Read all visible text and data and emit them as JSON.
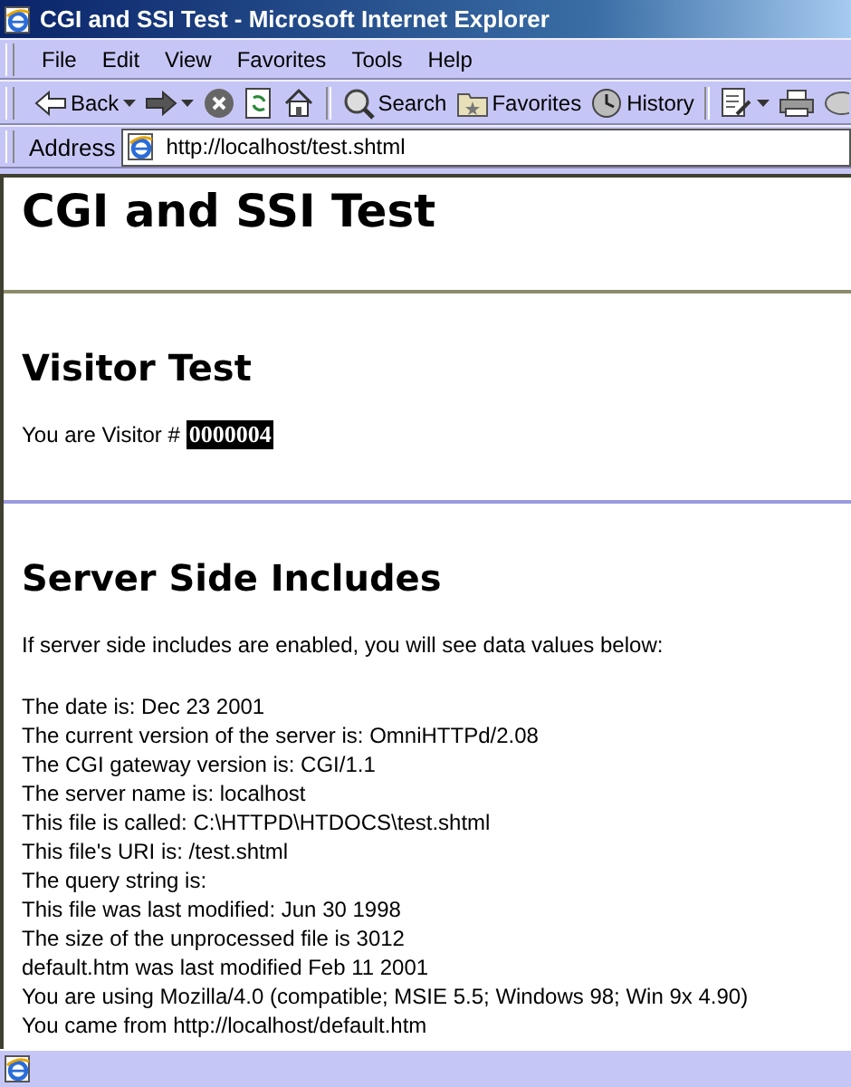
{
  "window": {
    "title": "CGI and SSI Test - Microsoft Internet Explorer"
  },
  "menu": [
    "File",
    "Edit",
    "View",
    "Favorites",
    "Tools",
    "Help"
  ],
  "toolbar": [
    {
      "kind": "back",
      "label": "Back",
      "dropdown": true
    },
    {
      "kind": "forward",
      "dropdown": true
    },
    {
      "kind": "stop"
    },
    {
      "kind": "refresh"
    },
    {
      "kind": "home"
    },
    {
      "kind": "separator"
    },
    {
      "kind": "search",
      "label": "Search"
    },
    {
      "kind": "favorites",
      "label": "Favorites"
    },
    {
      "kind": "history",
      "label": "History"
    },
    {
      "kind": "separator"
    },
    {
      "kind": "edit",
      "dropdown": true
    },
    {
      "kind": "print"
    },
    {
      "kind": "discuss"
    }
  ],
  "address": {
    "label": "Address",
    "value": "http://localhost/test.shtml"
  },
  "page": [
    {
      "kind": "h1",
      "text": "CGI and SSI Test"
    },
    {
      "kind": "hr",
      "color": "#8c8c6c"
    },
    {
      "kind": "h2",
      "text": "Visitor Test"
    },
    {
      "kind": "visitor",
      "label": "You are Visitor #",
      "count": "0000004"
    },
    {
      "kind": "hr",
      "color": "#9a9ae0"
    },
    {
      "kind": "h2",
      "text": "Server Side Includes"
    },
    {
      "kind": "p",
      "text": "If server side includes are enabled, you will see data values below:"
    },
    {
      "kind": "lines",
      "lines": [
        "The date is: Dec 23 2001",
        "The current version of the server is: OmniHTTPd/2.08",
        "The CGI gateway version is: CGI/1.1",
        "The server name is: localhost",
        "This file is called: C:\\HTTPD\\HTDOCS\\test.shtml",
        "This file's URI is: /test.shtml",
        "The query string is:",
        "This file was last modified: Jun 30 1998",
        "The size of the unprocessed file is 3012",
        "default.htm was last modified Feb 11 2001",
        "You are using Mozilla/4.0 (compatible; MSIE 5.5; Windows 98; Win 9x 4.90)",
        "You came from http://localhost/default.htm"
      ]
    }
  ]
}
